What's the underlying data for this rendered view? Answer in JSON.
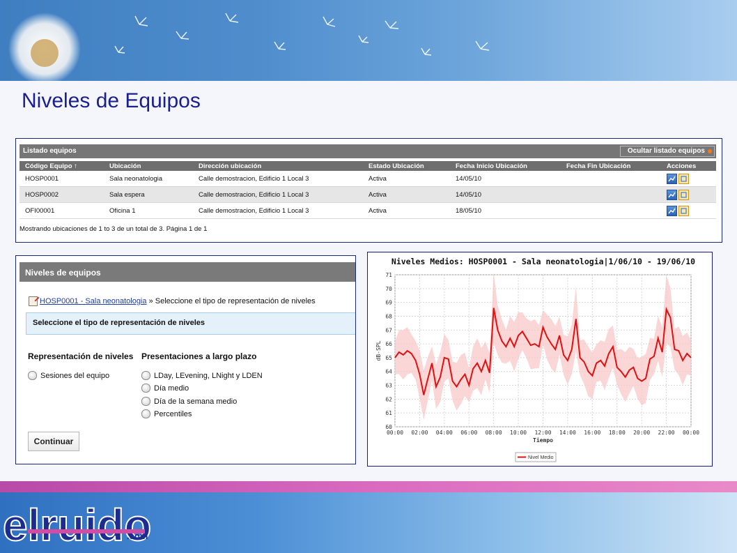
{
  "page": {
    "title": "Niveles de Equipos"
  },
  "listing": {
    "title": "Listado equipos",
    "hide_button": "Ocultar listado equipos",
    "columns": [
      "Código Equipo ↑",
      "Ubicación",
      "Dirección ubicación",
      "Estado Ubicación",
      "Fecha Inicio Ubicación",
      "Fecha Fin Ubicación",
      "Acciones"
    ],
    "rows": [
      {
        "codigo": "HOSP0001",
        "ubicacion": "Sala neonatologia",
        "direccion": "Calle demostracion, Edificio 1 Local 3",
        "estado": "Activa",
        "inicio": "14/05/10",
        "fin": ""
      },
      {
        "codigo": "HOSP0002",
        "ubicacion": "Sala espera",
        "direccion": "Calle demostracion, Edificio 1 Local 3",
        "estado": "Activa",
        "inicio": "14/05/10",
        "fin": ""
      },
      {
        "codigo": "OFI00001",
        "ubicacion": "Oficina 1",
        "direccion": "Calle demostracion, Edificio 1 Local 3",
        "estado": "Activa",
        "inicio": "18/05/10",
        "fin": ""
      }
    ],
    "icons": [
      "chart-icon",
      "map-icon"
    ],
    "summary": "Mostrando ubicaciones de 1 to 3 de un total de 3. Página 1 de 1"
  },
  "levels": {
    "title": "Niveles de equipos",
    "breadcrumb_link": "HOSP0001 - Sala neonatologia",
    "breadcrumb_sep": "»",
    "breadcrumb_text": "Seleccione el tipo de representación de niveles",
    "info_box": "Seleccione el tipo de representación de niveles",
    "col1_title": "Representación de niveles",
    "col2_title": "Presentaciones a largo plazo",
    "col1_options": [
      "Sesiones del equipo"
    ],
    "col2_options": [
      "LDay, LEvening, LNight y LDEN",
      "Día medio",
      "Día de la semana medio",
      "Percentiles"
    ],
    "continue": "Continuar"
  },
  "chart_data": {
    "type": "line",
    "title": "Niveles Medios: HOSP0001 - Sala neonatologia|1/06/10 - 19/06/10",
    "xlabel": "Tiempo",
    "ylabel": "dB-SPL",
    "x_ticks": [
      "00:00",
      "02:00",
      "04:00",
      "06:00",
      "08:00",
      "10:00",
      "12:00",
      "14:00",
      "16:00",
      "18:00",
      "20:00",
      "22:00",
      "00:00"
    ],
    "xlim": [
      0,
      24
    ],
    "ylim": [
      60,
      71
    ],
    "y_ticks": [
      60,
      61,
      62,
      63,
      64,
      65,
      66,
      67,
      68,
      69,
      70,
      71
    ],
    "grid": true,
    "legend": "bottom",
    "series": [
      {
        "name": "Nivel Medio",
        "color": "#e01010",
        "x": [
          0,
          0.33,
          0.67,
          1,
          1.33,
          1.67,
          2,
          2.33,
          2.67,
          3,
          3.33,
          3.67,
          4,
          4.33,
          4.67,
          5,
          5.33,
          5.67,
          6,
          6.33,
          6.67,
          7,
          7.33,
          7.67,
          8,
          8.33,
          8.67,
          9,
          9.33,
          9.67,
          10,
          10.33,
          10.67,
          11,
          11.33,
          11.67,
          12,
          12.33,
          12.67,
          13,
          13.33,
          13.67,
          14,
          14.33,
          14.67,
          15,
          15.33,
          15.67,
          16,
          16.33,
          16.67,
          17,
          17.33,
          17.67,
          18,
          18.33,
          18.67,
          19,
          19.33,
          19.67,
          20,
          20.33,
          20.67,
          21,
          21.33,
          21.67,
          22,
          22.33,
          22.67,
          23,
          23.33,
          23.67,
          24
        ],
        "values": [
          65.0,
          65.4,
          65.2,
          65.5,
          65.3,
          64.8,
          63.8,
          62.3,
          63.5,
          64.6,
          62.9,
          63.6,
          65.0,
          64.9,
          63.3,
          62.9,
          63.4,
          63.8,
          63.0,
          64.2,
          64.6,
          64.0,
          64.8,
          63.9,
          68.6,
          67.0,
          66.2,
          65.8,
          66.4,
          65.8,
          66.6,
          66.9,
          66.4,
          65.9,
          66.0,
          65.8,
          67.2,
          66.5,
          66.0,
          65.6,
          66.6,
          65.2,
          64.8,
          65.6,
          67.8,
          65.0,
          64.7,
          64.0,
          63.7,
          64.6,
          64.8,
          64.4,
          65.3,
          65.8,
          64.3,
          64.0,
          63.6,
          64.1,
          64.3,
          63.5,
          63.3,
          63.5,
          64.9,
          65.1,
          66.4,
          65.4,
          68.5,
          67.9,
          65.6,
          65.5,
          64.8,
          65.3,
          65.0
        ]
      }
    ]
  }
}
